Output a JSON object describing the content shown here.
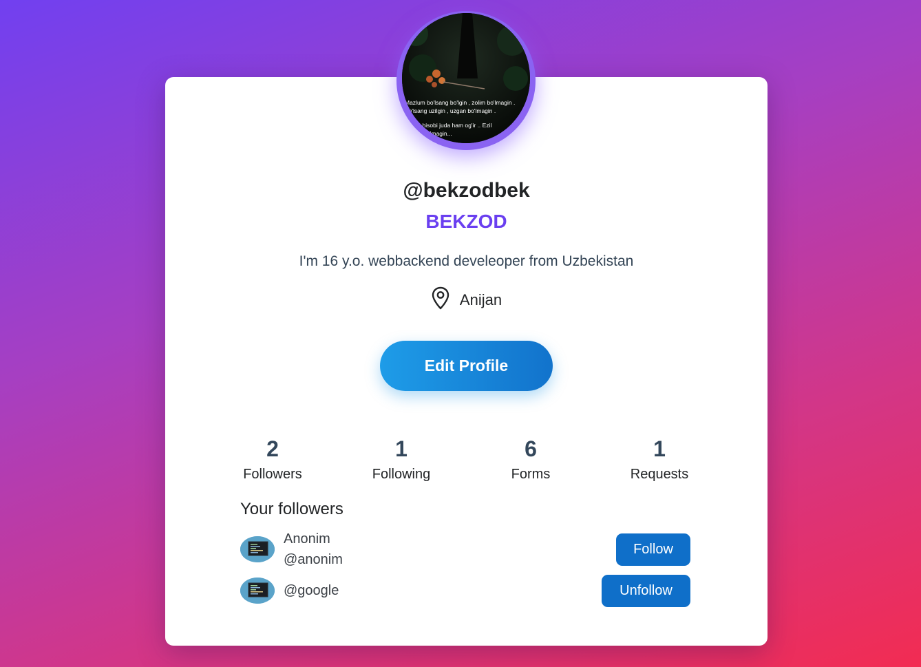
{
  "profile": {
    "username": "@bekzodbek",
    "full_name": "BEKZOD",
    "bio": "I'm 16 y.o. webbackend develeoper from Uzbekistan",
    "location": "Anijan",
    "location_icon": "map-pin-icon",
    "avatar_caption_lines": [
      "Mazlum bo'lsang bo'lgin , zolim bo'lmagin .",
      "Bo'lsang uzilgin , uzgan bo'lmagin .",
      "Narda hisobi juda ham og'ir .. Ezil",
      "ezgan bo'lmagin..."
    ]
  },
  "actions": {
    "edit_profile_label": "Edit Profile"
  },
  "stats": [
    {
      "value": "2",
      "label": "Followers"
    },
    {
      "value": "1",
      "label": "Following"
    },
    {
      "value": "6",
      "label": "Forms"
    },
    {
      "value": "1",
      "label": "Requests"
    }
  ],
  "followers_section": {
    "title": "Your followers",
    "items": [
      {
        "name": "Anonim",
        "handle": "@anonim",
        "button_label": "Follow"
      },
      {
        "name": "",
        "handle": "@google",
        "button_label": "Unfollow"
      }
    ]
  },
  "colors": {
    "accent_purple": "#6a3ff0",
    "button_blue": "#0f6fc9",
    "edit_gradient_start": "#1e9ce8",
    "edit_gradient_end": "#1273cc",
    "stat_number": "#33475b"
  }
}
